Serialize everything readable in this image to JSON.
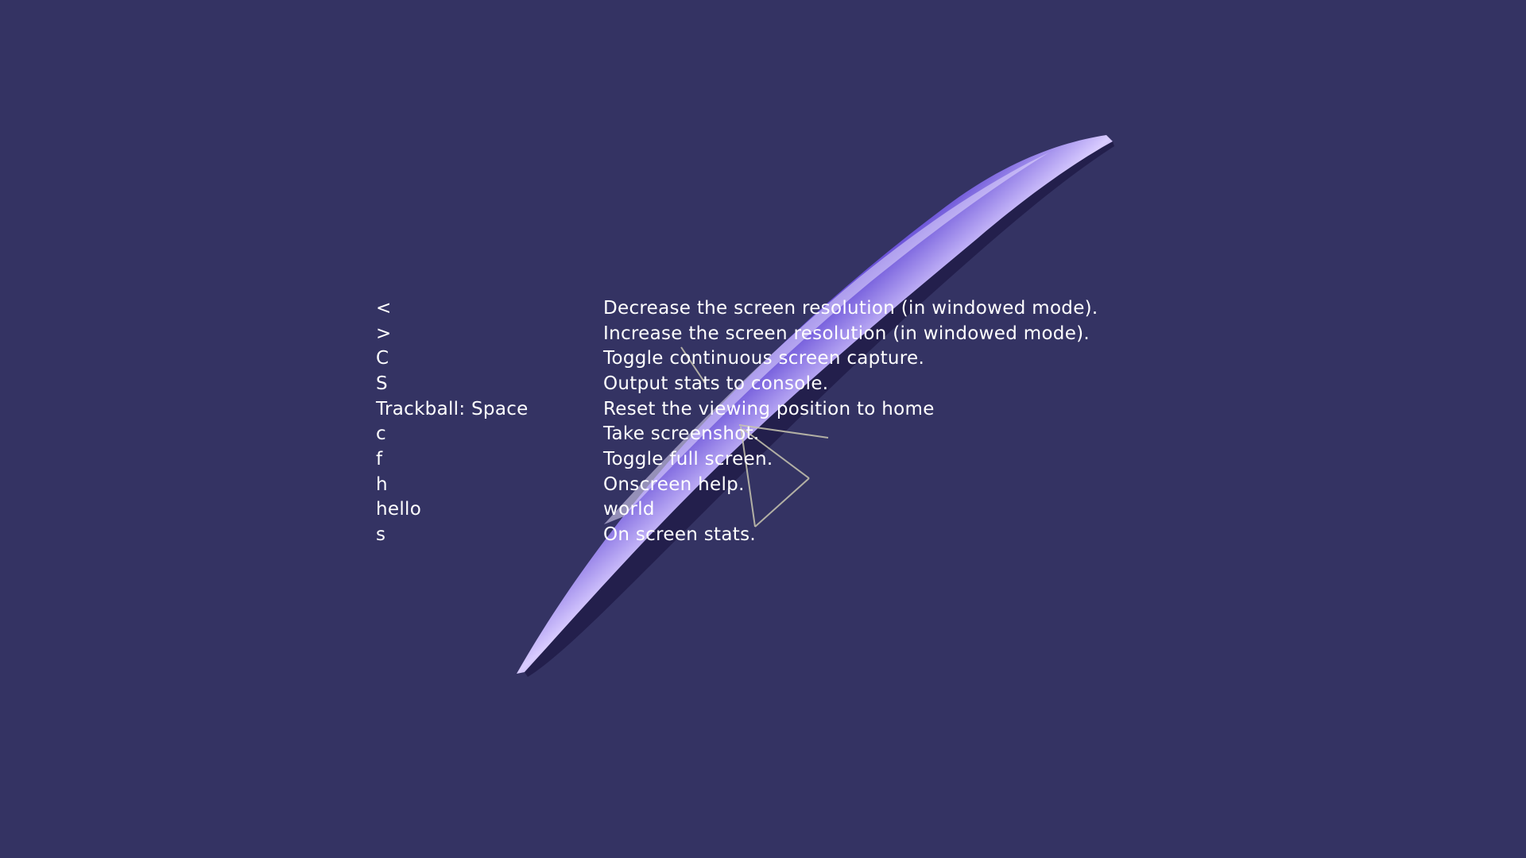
{
  "viewer": {
    "background_color": "#343363",
    "model_color": "#5b45c8",
    "highlight_color": "#c8b8ff",
    "text_color": "#ffffff"
  },
  "help": {
    "rows": [
      {
        "key": "<",
        "description": "Decrease the screen resolution (in windowed mode)."
      },
      {
        "key": ">",
        "description": "Increase the screen resolution (in windowed mode)."
      },
      {
        "key": "C",
        "description": "Toggle continuous screen capture."
      },
      {
        "key": "S",
        "description": "Output stats to console."
      },
      {
        "key": "Trackball: Space",
        "description": "Reset the viewing position to home"
      },
      {
        "key": "c",
        "description": "Take screenshot."
      },
      {
        "key": "f",
        "description": "Toggle full screen."
      },
      {
        "key": "h",
        "description": "Onscreen help."
      },
      {
        "key": "hello",
        "description": "world"
      },
      {
        "key": "s",
        "description": "On screen stats."
      }
    ]
  }
}
